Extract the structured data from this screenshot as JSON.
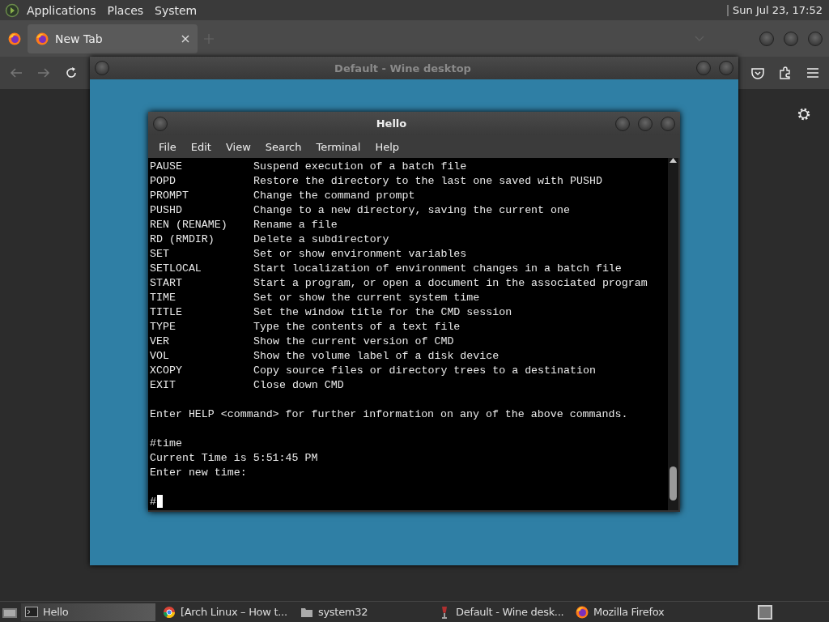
{
  "top_panel": {
    "menus": [
      "Applications",
      "Places",
      "System"
    ],
    "clock": "Sun Jul 23, 17:52"
  },
  "browser": {
    "tabs": [
      {
        "label": "New Tab",
        "selected": true
      }
    ]
  },
  "wine_window": {
    "title": "Default - Wine desktop"
  },
  "terminal_window": {
    "title": "Hello",
    "menu": [
      "File",
      "Edit",
      "View",
      "Search",
      "Terminal",
      "Help"
    ],
    "lines": [
      {
        "kind": "row",
        "command": "PAUSE",
        "description": "Suspend execution of a batch file"
      },
      {
        "kind": "row",
        "command": "POPD",
        "description": "Restore the directory to the last one saved with PUSHD"
      },
      {
        "kind": "row",
        "command": "PROMPT",
        "description": "Change the command prompt"
      },
      {
        "kind": "row",
        "command": "PUSHD",
        "description": "Change to a new directory, saving the current one"
      },
      {
        "kind": "row",
        "command": "REN (RENAME)",
        "description": "Rename a file"
      },
      {
        "kind": "row",
        "command": "RD (RMDIR)",
        "description": "Delete a subdirectory"
      },
      {
        "kind": "row",
        "command": "SET",
        "description": "Set or show environment variables"
      },
      {
        "kind": "row",
        "command": "SETLOCAL",
        "description": "Start localization of environment changes in a batch file"
      },
      {
        "kind": "row",
        "command": "START",
        "description": "Start a program, or open a document in the associated program"
      },
      {
        "kind": "row",
        "command": "TIME",
        "description": "Set or show the current system time"
      },
      {
        "kind": "row",
        "command": "TITLE",
        "description": "Set the window title for the CMD session"
      },
      {
        "kind": "row",
        "command": "TYPE",
        "description": "Type the contents of a text file"
      },
      {
        "kind": "row",
        "command": "VER",
        "description": "Show the current version of CMD"
      },
      {
        "kind": "row",
        "command": "VOL",
        "description": "Show the volume label of a disk device"
      },
      {
        "kind": "row",
        "command": "XCOPY",
        "description": "Copy source files or directory trees to a destination"
      },
      {
        "kind": "row",
        "command": "EXIT",
        "description": "Close down CMD"
      },
      {
        "kind": "blank"
      },
      {
        "kind": "text",
        "text": "Enter HELP <command> for further information on any of the above commands."
      },
      {
        "kind": "blank"
      },
      {
        "kind": "text",
        "text": "#time"
      },
      {
        "kind": "text",
        "text": "Current Time is 5:51:45 PM"
      },
      {
        "kind": "text",
        "text": "Enter new time:"
      },
      {
        "kind": "blank"
      },
      {
        "kind": "prompt",
        "text": "#"
      }
    ]
  },
  "taskbar": {
    "items": [
      {
        "kind": "terminal",
        "label": "Hello",
        "selected": true
      },
      {
        "kind": "browser",
        "label": "[Arch Linux – How t...",
        "selected": false
      },
      {
        "kind": "folder",
        "label": "system32",
        "selected": false
      },
      {
        "kind": "wine",
        "label": "Default - Wine desk...",
        "selected": false
      },
      {
        "kind": "firefox",
        "label": "Mozilla Firefox",
        "selected": false
      }
    ]
  }
}
